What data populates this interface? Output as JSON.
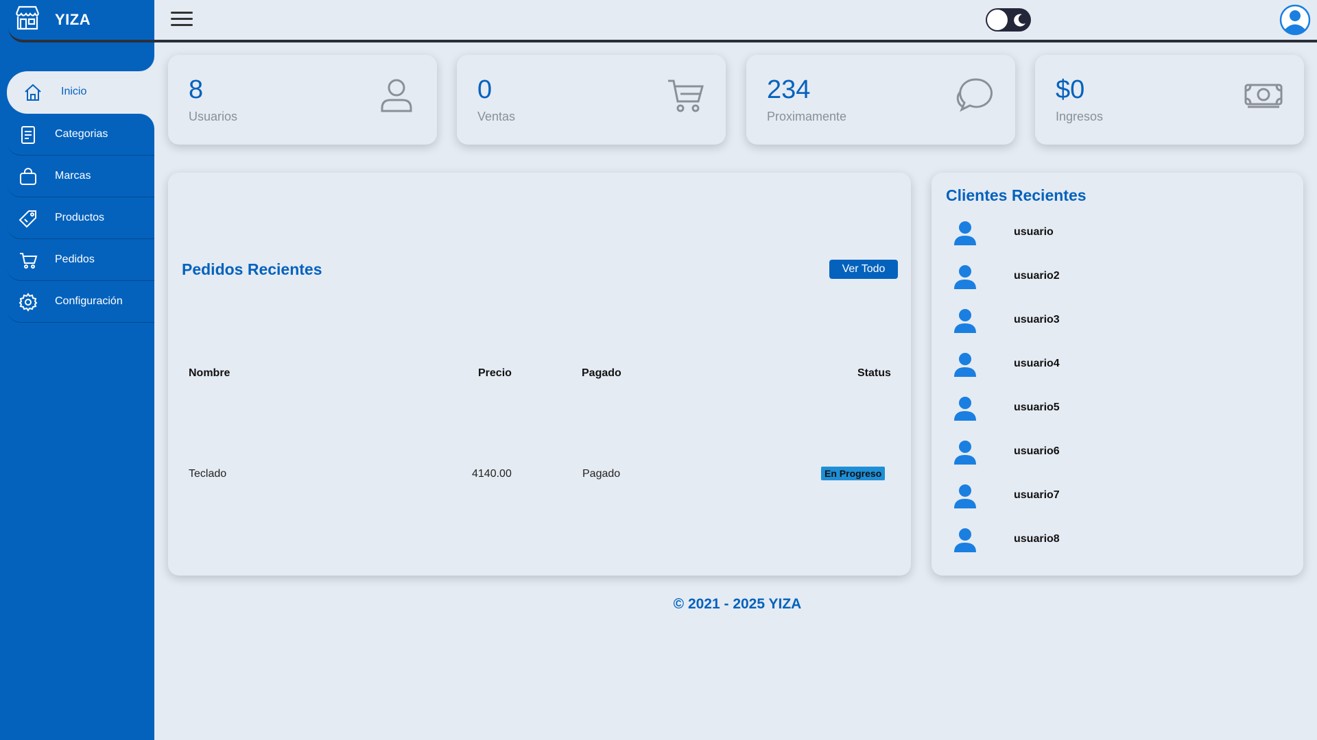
{
  "brand": {
    "name": "YIZA",
    "icon": "store-icon"
  },
  "sidebar": {
    "items": [
      {
        "label": "Inicio",
        "icon": "home-icon",
        "active": true
      },
      {
        "label": "Categorias",
        "icon": "document-icon"
      },
      {
        "label": "Marcas",
        "icon": "bag-icon"
      },
      {
        "label": "Productos",
        "icon": "tag-icon"
      },
      {
        "label": "Pedidos",
        "icon": "cart-icon"
      },
      {
        "label": "Configuración",
        "icon": "gear-icon"
      }
    ]
  },
  "topbar": {
    "menu_icon": "hamburger-icon",
    "theme_toggle": "dark-mode-toggle",
    "avatar_icon": "user-avatar-icon"
  },
  "cards": [
    {
      "value": "8",
      "label": "Usuarios",
      "icon": "user-icon"
    },
    {
      "value": "0",
      "label": "Ventas",
      "icon": "cart-icon"
    },
    {
      "value": "234",
      "label": "Proximamente",
      "icon": "chat-icon"
    },
    {
      "value": "$0",
      "label": "Ingresos",
      "icon": "money-icon"
    }
  ],
  "orders": {
    "title": "Pedidos Recientes",
    "view_all": "Ver Todo",
    "columns": [
      "Nombre",
      "Precio",
      "Pagado",
      "Status"
    ],
    "rows": [
      {
        "nombre": "Teclado",
        "precio": "4140.00",
        "pagado": "Pagado",
        "status": "En Progreso"
      }
    ]
  },
  "clients": {
    "title": "Clientes Recientes",
    "items": [
      "usuario",
      "usuario2",
      "usuario3",
      "usuario4",
      "usuario5",
      "usuario6",
      "usuario7",
      "usuario8"
    ]
  },
  "footer": {
    "text": "© 2021 - 2025 YIZA"
  },
  "colors": {
    "primary": "#0462bd",
    "background": "#e5ebf3",
    "badge": "#1e8fd6"
  }
}
